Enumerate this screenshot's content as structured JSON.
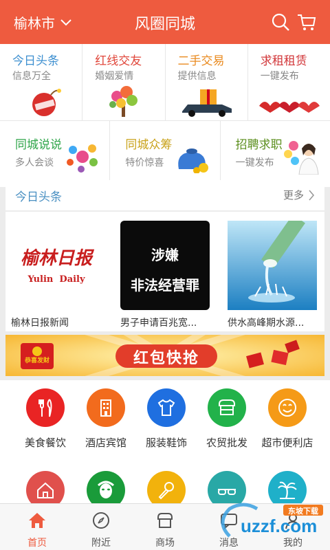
{
  "header": {
    "city": "榆林市",
    "title": "风圈同城"
  },
  "categories_row1": [
    {
      "title": "今日头条",
      "sub": "信息万全",
      "color": "#3d8fd0"
    },
    {
      "title": "红线交友",
      "sub": "婚姻爱情",
      "color": "#e0463a"
    },
    {
      "title": "二手交易",
      "sub": "提供信息",
      "color": "#e98a1f"
    },
    {
      "title": "求租租赁",
      "sub": "一键发布",
      "color": "#d2373a"
    }
  ],
  "categories_row2": [
    {
      "title": "同城说说",
      "sub": "多人会谈",
      "color": "#2fa54a"
    },
    {
      "title": "同城众筹",
      "sub": "特价惊喜",
      "color": "#c9a21a"
    },
    {
      "title": "招聘求职",
      "sub": "一键发布",
      "color": "#5c8f1e"
    }
  ],
  "news_section": {
    "label": "今日头条",
    "more": "更多"
  },
  "news_items": [
    {
      "caption": "榆林日报新闻",
      "logo_cn": "榆林日报",
      "logo_en": "Yulin  Daily"
    },
    {
      "caption": "男子申请百兆宽...",
      "line1": "涉嫌",
      "line2": "非法经营罪"
    },
    {
      "caption": "供水高峰期水源..."
    }
  ],
  "banner": {
    "text": "红包快抢",
    "envelope_text": "恭喜发财"
  },
  "services_row1": [
    {
      "label": "美食餐饮",
      "color": "#e92424",
      "icon": "fork-spoon-icon"
    },
    {
      "label": "酒店宾馆",
      "color": "#f26b1d",
      "icon": "building-icon"
    },
    {
      "label": "服装鞋饰",
      "color": "#1f6fe0",
      "icon": "shirt-icon"
    },
    {
      "label": "农贸批发",
      "color": "#22b24a",
      "icon": "store-icon"
    },
    {
      "label": "超市便利店",
      "color": "#f59a17",
      "icon": "smile-icon"
    }
  ],
  "services_row2": [
    {
      "color": "#e0504c",
      "icon": "house-icon"
    },
    {
      "color": "#1a9b3a",
      "icon": "face-icon"
    },
    {
      "color": "#f2b20c",
      "icon": "microphone-icon"
    },
    {
      "color": "#29a8a6",
      "icon": "glasses-icon"
    },
    {
      "color": "#1fb0c9",
      "icon": "palm-tree-icon"
    }
  ],
  "tabs": [
    {
      "label": "首页",
      "active": true
    },
    {
      "label": "附近",
      "active": false
    },
    {
      "label": "商场",
      "active": false
    },
    {
      "label": "消息",
      "active": false
    },
    {
      "label": "我的",
      "active": false
    }
  ],
  "watermark": {
    "brand": "uzzf.com",
    "sub": "东坡下载"
  },
  "colors": {
    "brand": "#ee5b3f",
    "link": "#4a90c2"
  }
}
